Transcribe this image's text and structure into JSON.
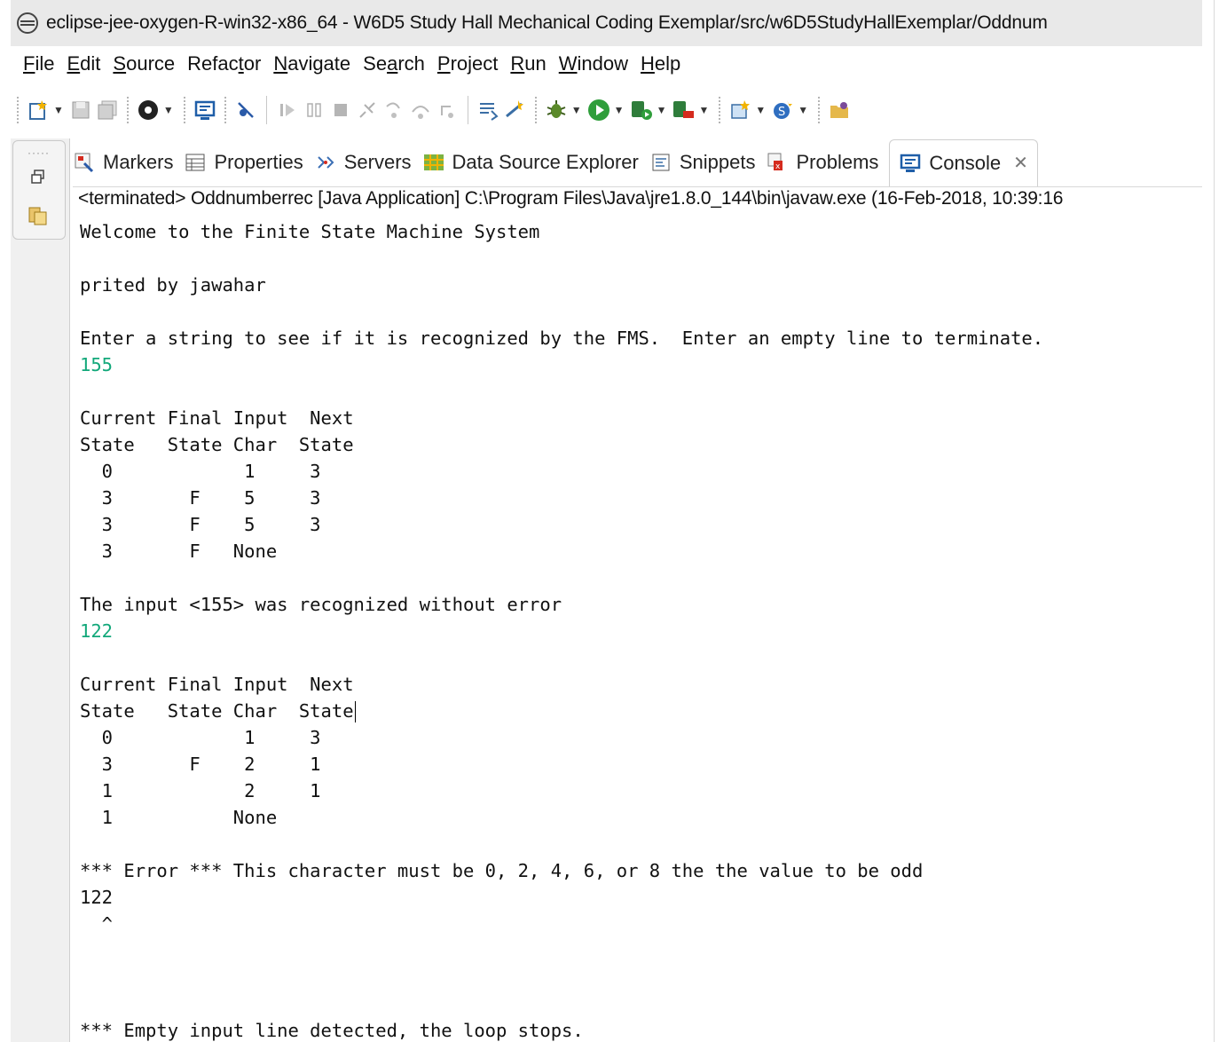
{
  "window": {
    "title": "eclipse-jee-oxygen-R-win32-x86_64 - W6D5 Study Hall Mechanical Coding Exemplar/src/w6D5StudyHallExemplar/Oddnum"
  },
  "menu": [
    {
      "pre": "",
      "u": "F",
      "post": "ile"
    },
    {
      "pre": "",
      "u": "E",
      "post": "dit"
    },
    {
      "pre": "",
      "u": "S",
      "post": "ource"
    },
    {
      "pre": "Refac",
      "u": "t",
      "post": "or"
    },
    {
      "pre": "",
      "u": "N",
      "post": "avigate"
    },
    {
      "pre": "Se",
      "u": "a",
      "post": "rch"
    },
    {
      "pre": "",
      "u": "P",
      "post": "roject"
    },
    {
      "pre": "",
      "u": "R",
      "post": "un"
    },
    {
      "pre": "",
      "u": "W",
      "post": "indow"
    },
    {
      "pre": "",
      "u": "H",
      "post": "elp"
    }
  ],
  "tabs": {
    "markers": "Markers",
    "properties": "Properties",
    "servers": "Servers",
    "data_source_explorer": "Data Source Explorer",
    "snippets": "Snippets",
    "problems": "Problems",
    "console": "Console"
  },
  "console": {
    "status": "<terminated> Oddnumberrec [Java Application] C:\\Program Files\\Java\\jre1.8.0_144\\bin\\javaw.exe (16-Feb-2018, 10:39:16",
    "lines": [
      {
        "text": "Welcome to the Finite State Machine System",
        "kind": "out"
      },
      {
        "text": "",
        "kind": "out"
      },
      {
        "text": "prited by jawahar",
        "kind": "out"
      },
      {
        "text": "",
        "kind": "out"
      },
      {
        "text": "Enter a string to see if it is recognized by the FMS.  Enter an empty line to terminate.",
        "kind": "out"
      },
      {
        "text": "155",
        "kind": "input"
      },
      {
        "text": "",
        "kind": "out"
      },
      {
        "text": "Current Final Input  Next",
        "kind": "out"
      },
      {
        "text": "State   State Char  State",
        "kind": "out"
      },
      {
        "text": "  0            1     3",
        "kind": "out"
      },
      {
        "text": "  3       F    5     3",
        "kind": "out"
      },
      {
        "text": "  3       F    5     3",
        "kind": "out"
      },
      {
        "text": "  3       F   None",
        "kind": "out"
      },
      {
        "text": "",
        "kind": "out"
      },
      {
        "text": "The input <155> was recognized without error",
        "kind": "out"
      },
      {
        "text": "122",
        "kind": "input"
      },
      {
        "text": "",
        "kind": "out"
      },
      {
        "text": "Current Final Input  Next",
        "kind": "out"
      },
      {
        "text": "State   State Char  State",
        "kind": "out",
        "caret": true
      },
      {
        "text": "  0            1     3",
        "kind": "out"
      },
      {
        "text": "  3       F    2     1",
        "kind": "out"
      },
      {
        "text": "  1            2     1",
        "kind": "out"
      },
      {
        "text": "  1           None",
        "kind": "out"
      },
      {
        "text": "",
        "kind": "out"
      },
      {
        "text": "*** Error *** This character must be 0, 2, 4, 6, or 8 the the value to be odd",
        "kind": "out"
      },
      {
        "text": "122",
        "kind": "out"
      },
      {
        "text": "  ^",
        "kind": "out"
      },
      {
        "text": "",
        "kind": "out"
      },
      {
        "text": "",
        "kind": "out"
      },
      {
        "text": "",
        "kind": "out"
      },
      {
        "text": "*** Empty input line detected, the loop stops.",
        "kind": "out"
      }
    ]
  },
  "colors": {
    "input_text": "#12a87a",
    "title_bar": "#e9e9e9"
  }
}
